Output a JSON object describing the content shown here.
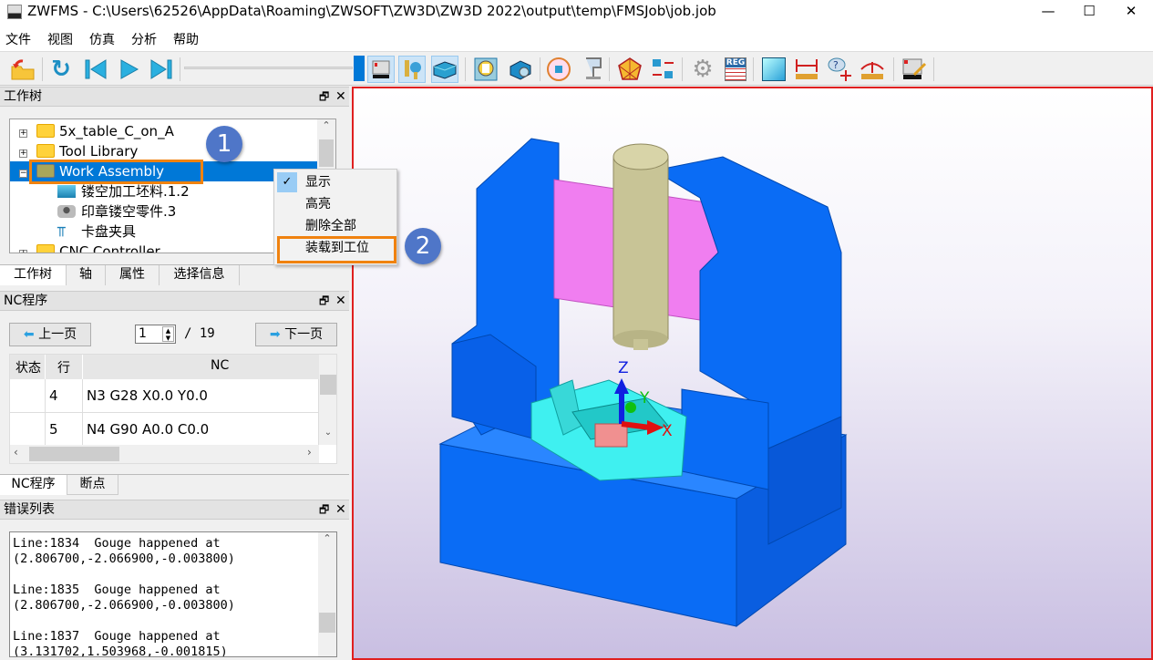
{
  "window": {
    "title": "ZWFMS - C:\\Users\\62526\\AppData\\Roaming\\ZWSOFT\\ZW3D\\ZW3D 2022\\output\\temp\\FMSJob\\job.job",
    "minimize": "—",
    "maximize": "☐",
    "close": "✕"
  },
  "menu": [
    "文件",
    "视图",
    "仿真",
    "分析",
    "帮助"
  ],
  "toolbar": {
    "icons": [
      "open-folder-icon",
      "rewind-icon",
      "step-back-icon",
      "play-icon",
      "step-forward-icon",
      "machine-view-icon",
      "tool-view-icon",
      "stock-view-icon",
      "report-icon",
      "inspect-icon",
      "workpiece-icon",
      "fixture-icon",
      "polyhedron-icon",
      "swap-icon",
      "settings-icon",
      "register-icon",
      "solid-view-icon",
      "measure-distance-icon",
      "query-icon",
      "measure-arc-icon",
      "machine-setup-icon"
    ],
    "slider_progress": 1.0,
    "REG": "REG"
  },
  "work_tree": {
    "title": "工作树",
    "items": [
      {
        "label": "5x_table_C_on_A",
        "expander": "+"
      },
      {
        "label": "Tool Library",
        "expander": "+"
      },
      {
        "label": "Work Assembly",
        "expander": "−",
        "selected": true
      },
      {
        "label": "镂空加工坯料.1.2",
        "child": true,
        "icon": "stock-icon"
      },
      {
        "label": "印章镂空零件.3",
        "child": true,
        "icon": "part-icon"
      },
      {
        "label": "卡盘夹具",
        "child": true,
        "icon": "fixture-icon"
      },
      {
        "label": "CNC Controller",
        "expander": "+"
      }
    ],
    "tabs": [
      "工作树",
      "轴",
      "属性",
      "选择信息"
    ]
  },
  "context_menu": {
    "items": [
      {
        "label": "显示",
        "checked": true
      },
      {
        "label": "高亮"
      },
      {
        "label": "删除全部"
      },
      {
        "label": "装载到工位",
        "highlighted": true
      }
    ]
  },
  "callouts": [
    "1",
    "2"
  ],
  "nc_program": {
    "title": "NC程序",
    "prev": "上一页",
    "next": "下一页",
    "page": "1",
    "total": "/ 19",
    "columns": [
      "状态",
      "行",
      "NC"
    ],
    "rows": [
      {
        "status": "",
        "line": "4",
        "nc": "N3 G28 X0.0 Y0.0"
      },
      {
        "status": "",
        "line": "5",
        "nc": "N4 G90 A0.0 C0.0"
      }
    ],
    "tabs": [
      "NC程序",
      "断点"
    ]
  },
  "error_list": {
    "title": "错误列表",
    "entries": [
      "Line:1834  Gouge happened at\n(2.806700,-2.066900,-0.003800)",
      "Line:1835  Gouge happened at\n(2.806700,-2.066900,-0.003800)",
      "Line:1837  Gouge happened at\n(3.131702,1.503968,-0.001815)"
    ]
  },
  "viewport": {
    "axes": {
      "x": "X",
      "y": "Y",
      "z": "Z"
    }
  },
  "colors": {
    "selection": "#0078d7",
    "highlight_box": "#f0820f",
    "callout": "#4f76c8",
    "viewport_border": "#e02020",
    "machine_blue": "#0a6cf5",
    "table_cyan": "#3ff0f0",
    "gantry_pink": "#f07ef0",
    "spindle": "#c8c496"
  }
}
